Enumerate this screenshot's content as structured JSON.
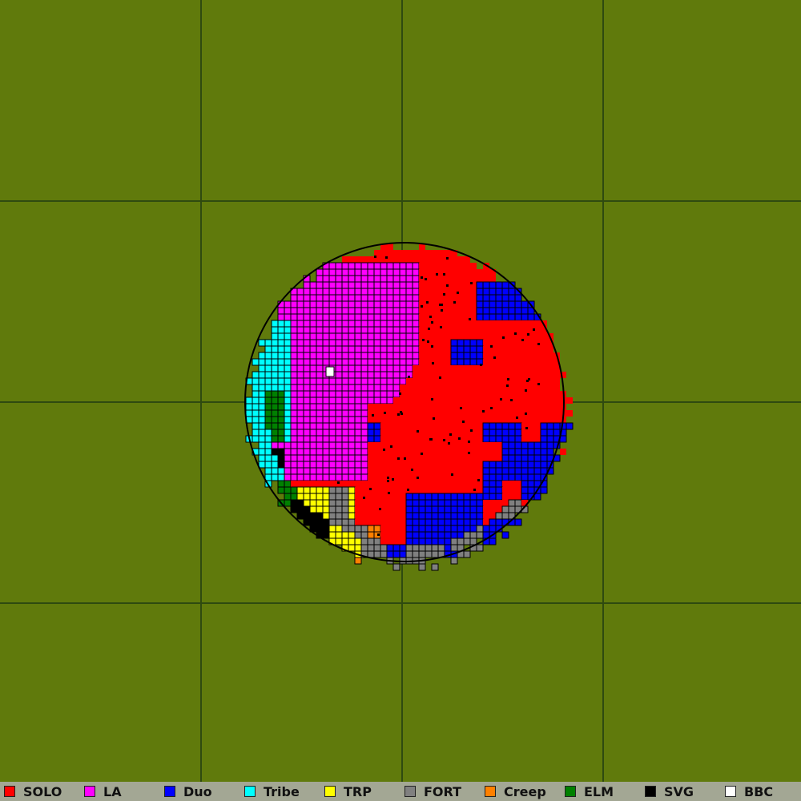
{
  "map": {
    "background_color": "#607a0c",
    "grid_color": "#2f4a10",
    "grid_divisions": 4
  },
  "factions": [
    {
      "key": "solo",
      "name": "SOLO",
      "color": "#ff0000",
      "share": 0.55
    },
    {
      "key": "la",
      "name": "LA",
      "color": "#ff00ff",
      "share": 0.17
    },
    {
      "key": "duo",
      "name": "Duo",
      "color": "#0000ff",
      "share": 0.13
    },
    {
      "key": "tribe",
      "name": "Tribe",
      "color": "#00ffff",
      "share": 0.035
    },
    {
      "key": "trp",
      "name": "TRP",
      "color": "#ffff00",
      "share": 0.025
    },
    {
      "key": "fort",
      "name": "FORT",
      "color": "#808080",
      "share": 0.015
    },
    {
      "key": "creep",
      "name": "Creep",
      "color": "#ff8000",
      "share": 0.012
    },
    {
      "key": "elm",
      "name": "ELM",
      "color": "#008000",
      "share": 0.012
    },
    {
      "key": "svg",
      "name": "SVG",
      "color": "#000000",
      "share": 0.015
    },
    {
      "key": "bbc",
      "name": "BBC",
      "color": "#ffffff",
      "share": 0.002
    }
  ]
}
